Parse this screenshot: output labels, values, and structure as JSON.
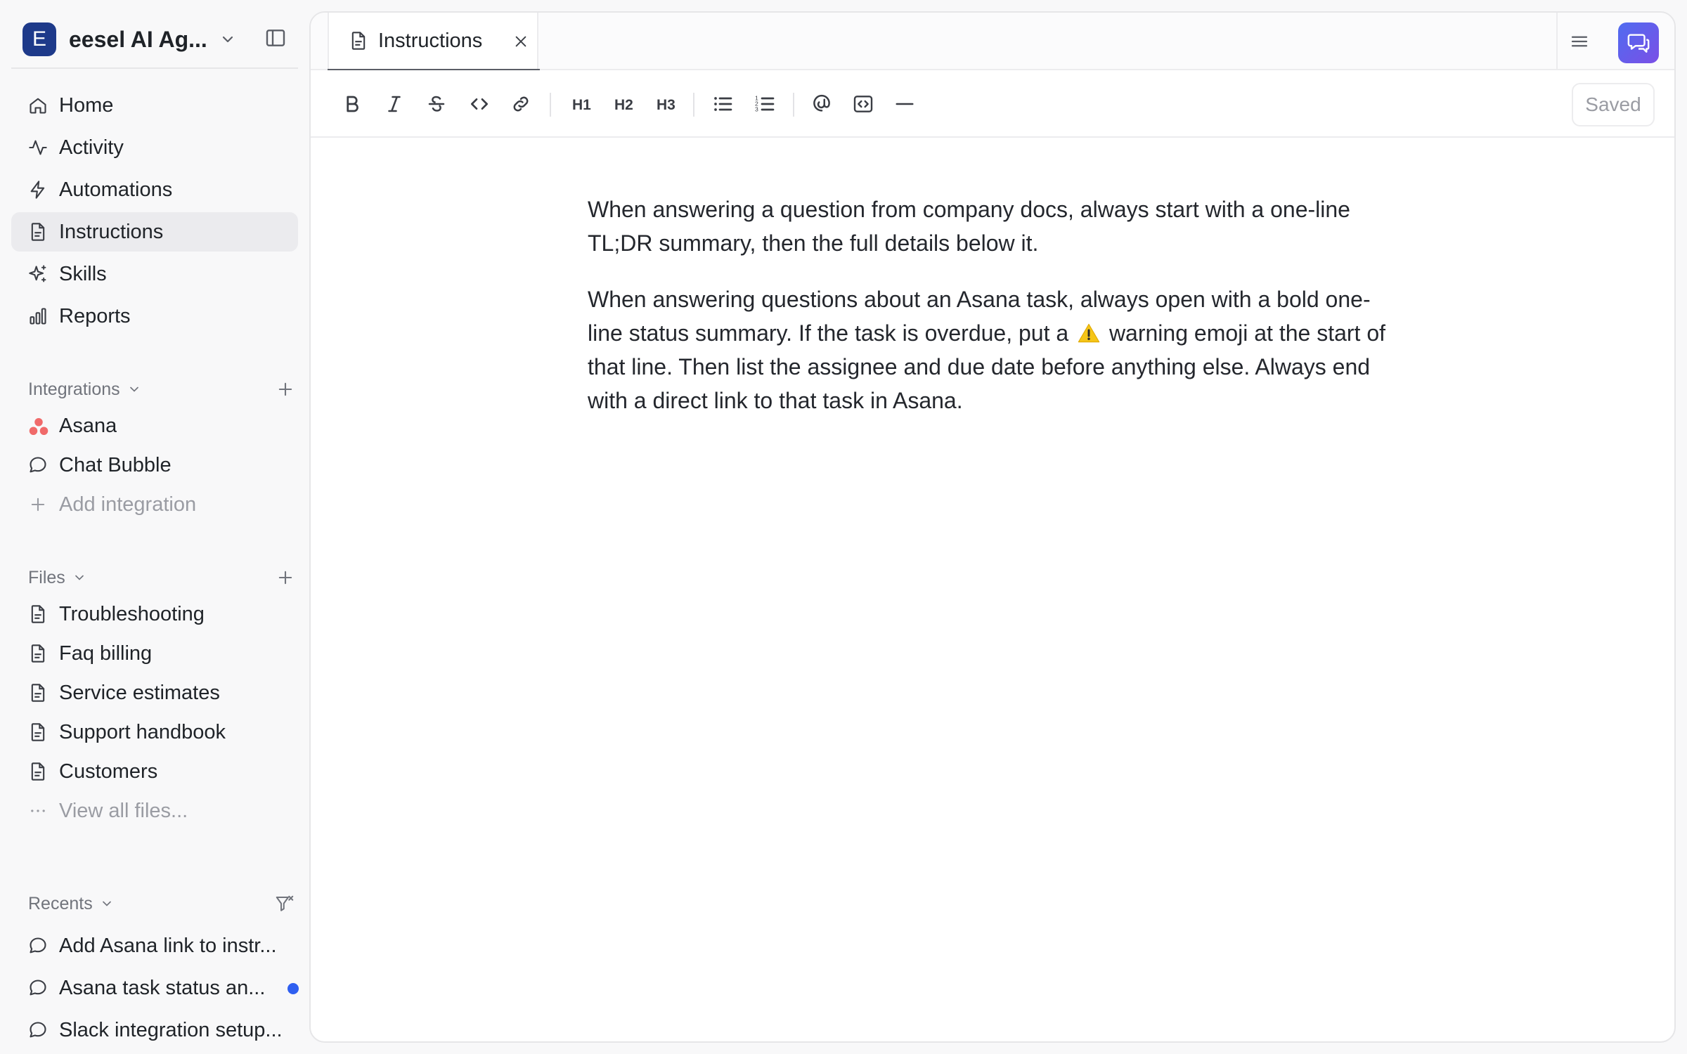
{
  "workspace": {
    "initial": "E",
    "name": "eesel AI Ag..."
  },
  "nav": [
    {
      "label": "Home",
      "icon": "home-icon"
    },
    {
      "label": "Activity",
      "icon": "activity-icon"
    },
    {
      "label": "Automations",
      "icon": "lightning-icon"
    },
    {
      "label": "Instructions",
      "icon": "document-icon",
      "active": true
    },
    {
      "label": "Skills",
      "icon": "sparkles-icon"
    },
    {
      "label": "Reports",
      "icon": "bar-chart-icon"
    }
  ],
  "integrations": {
    "title": "Integrations",
    "items": [
      {
        "label": "Asana",
        "icon": "asana-logo-icon"
      },
      {
        "label": "Chat Bubble",
        "icon": "chat-bubble-icon"
      }
    ],
    "add_label": "Add integration"
  },
  "files": {
    "title": "Files",
    "items": [
      {
        "label": "Troubleshooting"
      },
      {
        "label": "Faq billing"
      },
      {
        "label": "Service estimates"
      },
      {
        "label": "Support handbook"
      },
      {
        "label": "Customers"
      }
    ],
    "view_all_label": "View all files..."
  },
  "recents": {
    "title": "Recents",
    "items": [
      {
        "label": "Add Asana link to instr...",
        "unread": false
      },
      {
        "label": "Asana task status an...",
        "unread": true
      },
      {
        "label": "Slack integration setup...",
        "unread": false
      }
    ]
  },
  "tab": {
    "label": "Instructions"
  },
  "toolbar": {
    "h1": "H1",
    "h2": "H2",
    "h3": "H3",
    "saved_label": "Saved"
  },
  "colors": {
    "accent": "#2f5ff0",
    "workspace_avatar": "#1e3a8a",
    "asana": "#f06a6a"
  },
  "editor": {
    "p1": "When answering a question from company docs, always start with a one-line TL;DR summary, then the full details below it.",
    "p2_before": "When answering questions about an Asana task, always open with a bold one-line status summary. If the task is overdue, put a",
    "p2_after": "warning emoji at the start of that line. Then list the assignee and due date before anything else. Always end with a direct link to that task in Asana."
  }
}
